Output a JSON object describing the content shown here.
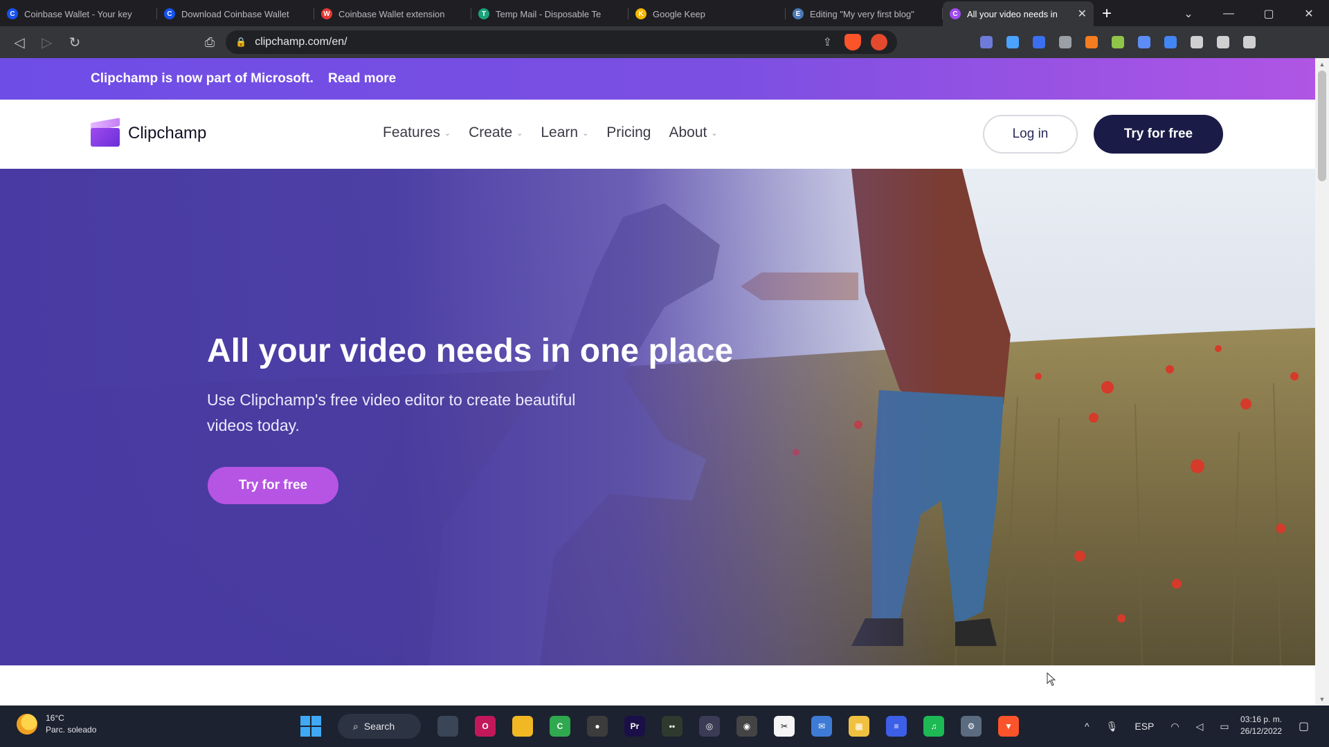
{
  "browser": {
    "tabs": [
      {
        "title": "Coinbase Wallet - Your key",
        "color": "#1652f0",
        "letter": "C"
      },
      {
        "title": "Download Coinbase Wallet",
        "color": "#1652f0",
        "letter": "C"
      },
      {
        "title": "Coinbase Wallet extension",
        "color": "#e53935",
        "letter": "W"
      },
      {
        "title": "Temp Mail - Disposable Te",
        "color": "#1aa37a",
        "letter": "T"
      },
      {
        "title": "Google Keep",
        "color": "#f6b800",
        "letter": "K"
      },
      {
        "title": "Editing \"My very first blog\"",
        "color": "#4a7ab8",
        "letter": "E"
      },
      {
        "title": "All your video needs in",
        "color": "#a04bf0",
        "letter": "C",
        "active": true
      }
    ],
    "close_tab_glyph": "✕",
    "new_tab_glyph": "+",
    "window_controls": {
      "list": "⌄",
      "minimize": "—",
      "maximize": "▢",
      "close": "✕"
    },
    "nav": {
      "back": "◁",
      "forward": "▷",
      "reload": "↻",
      "bookmark": "⎙"
    },
    "url": "clipchamp.com/en/",
    "share_glyph": "⇪",
    "extension_colors": [
      "#6e7bd8",
      "#4aa3ff",
      "#3b6ff0",
      "#9aa0a6",
      "#f57c1f",
      "#8fc549",
      "#5c8df6",
      "#4285f4",
      "#d0d0d0",
      "#d0d0d0",
      "#d0d0d0"
    ]
  },
  "site": {
    "banner": {
      "text": "Clipchamp is now part of Microsoft.",
      "link": "Read more"
    },
    "logo": "Clipchamp",
    "nav": [
      {
        "label": "Features",
        "dropdown": true
      },
      {
        "label": "Create",
        "dropdown": true
      },
      {
        "label": "Learn",
        "dropdown": true
      },
      {
        "label": "Pricing",
        "dropdown": false
      },
      {
        "label": "About",
        "dropdown": true
      }
    ],
    "chevron_glyph": "⌄",
    "login": "Log in",
    "try_header": "Try for free",
    "hero": {
      "title": "All your video needs in one place",
      "subtitle": "Use Clipchamp's free video editor to create beautiful videos today.",
      "cta": "Try for free"
    },
    "colors": {
      "banner_start": "#6e4de6",
      "banner_end": "#b055e4",
      "cta": "#b654e4",
      "header_btn": "#1b1b48",
      "hero_overlay": "#483aa2"
    }
  },
  "taskbar": {
    "weather_temp": "16°C",
    "weather_desc": "Parc. soleado",
    "search": "Search",
    "apps": [
      {
        "name": "file-explorer-icon",
        "color": "#3a4558",
        "label": ""
      },
      {
        "name": "opera-icon",
        "color": "#c2185b",
        "label": "O"
      },
      {
        "name": "folder-icon",
        "color": "#f2b824",
        "label": ""
      },
      {
        "name": "camtasia-icon",
        "color": "#2fa84f",
        "label": "C"
      },
      {
        "name": "obs-icon",
        "color": "#3c3c3c",
        "label": "●"
      },
      {
        "name": "premiere-icon",
        "color": "#1a1047",
        "label": "Pr"
      },
      {
        "name": "terminal-icon",
        "color": "#2d3a2d",
        "label": "▪▪"
      },
      {
        "name": "davinci-icon",
        "color": "#3b3b55",
        "label": "◎"
      },
      {
        "name": "chrome-icon",
        "color": "#444",
        "label": "◉"
      },
      {
        "name": "capcut-icon",
        "color": "#f5f5f5",
        "label": "✂"
      },
      {
        "name": "mail-icon",
        "color": "#3e7bd6",
        "label": "✉"
      },
      {
        "name": "store-icon",
        "color": "#f0c040",
        "label": "▦"
      },
      {
        "name": "vscode-icon",
        "color": "#3d5ee6",
        "label": "≡"
      },
      {
        "name": "spotify-icon",
        "color": "#1db954",
        "label": "♫"
      },
      {
        "name": "settings-icon",
        "color": "#5b6b80",
        "label": "⚙"
      },
      {
        "name": "brave-icon",
        "color": "#fb542b",
        "label": "▼"
      }
    ],
    "tray": {
      "chevron": "^",
      "mic": "🎙",
      "lang": "ESP",
      "wifi": "◠",
      "volume": "◁",
      "battery": "▭"
    },
    "time": "03:16 p. m.",
    "date": "26/12/2022",
    "notification_glyph": "▢"
  }
}
